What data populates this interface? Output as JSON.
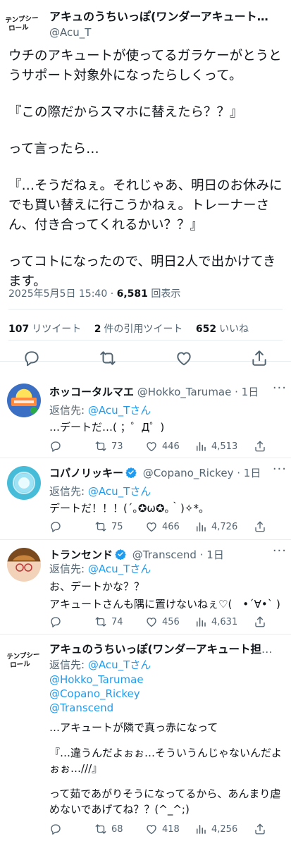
{
  "main_tweet": {
    "logo_line1": "テンプシー",
    "logo_line2": "ロール",
    "author_name": "アキュのうちいっぽ(ワンダーアキュート担当…",
    "author_handle": "@Acu_T",
    "text_paragraphs": [
      "ウチのアキュートが使ってるガラケーがとうとうサポート対象外になったらしくって。",
      "『この際だからスマホに替えたら？？』",
      "って言ったら…",
      "『…そうだねぇ。それじゃあ、明日のお休みにでも買い替えに行こうかねぇ。トレーナーさん、付き合ってくれるかい？？』",
      "ってコトになったので、明日2人で出かけてきます。"
    ],
    "timestamp": "2025年5月5日 15:40",
    "separator": "·",
    "views_count": "6,581",
    "views_label": "回表示",
    "retweets_count": "107",
    "retweets_label": "リツイート",
    "quotes_count": "2",
    "quotes_label": "件の引用ツイート",
    "likes_count": "652",
    "likes_label": "いいね"
  },
  "replies": [
    {
      "name": "ホッコータルマエ",
      "handle": "@Hokko_Tarumae",
      "time": "· 1日",
      "verified": false,
      "replying_label": "返信先:",
      "replying_to": "@Acu_Tさん",
      "text_lines": [
        "…デートだ…( ；゜Д゜)"
      ],
      "retweets": "73",
      "likes": "446",
      "views": "4,513",
      "avatar_color": "#3a6fc4"
    },
    {
      "name": "コパノリッキー",
      "handle": "@Copano_Rickey",
      "time": "· 1日",
      "verified": true,
      "replying_label": "返信先:",
      "replying_to": "@Acu_Tさん",
      "text_lines": [
        "デートだ！！！(´｡✪ω✪｡｀)✧*。"
      ],
      "retweets": "75",
      "likes": "466",
      "views": "4,726",
      "avatar_color": "#46bcd9"
    },
    {
      "name": "トランセンド",
      "handle": "@Transcend",
      "time": "· 1日",
      "verified": true,
      "replying_label": "返信先:",
      "replying_to": "@Acu_Tさん",
      "text_lines": [
        "お、デートかな？？",
        "アキュートさんも隅に置けないねぇ♡(　•´∀•` )"
      ],
      "retweets": "74",
      "likes": "456",
      "views": "4,631",
      "avatar_color": "#c9853e"
    },
    {
      "name": "アキュのうちいっぽ(ワンダーアキュート担当ト…",
      "handle": "",
      "time": "",
      "verified": false,
      "logo_line1": "テンプシー",
      "logo_line2": "ロール",
      "replying_label": "返信先:",
      "replying_to": "@Acu_Tさん",
      "mentions": [
        "@Hokko_Tarumae",
        "@Copano_Rickey",
        "@Transcend"
      ],
      "text_lines": [
        "…アキュートが隣で真っ赤になって",
        "『…違うんだよぉぉ…そういうんじゃないんだよぉぉ…///』",
        "って茹であがりそうになってるから、あんまり虐めないであげてね？？(^_^;)"
      ],
      "retweets": "68",
      "likes": "418",
      "views": "4,256"
    }
  ],
  "colors": {
    "text": "#0f1419",
    "muted": "#536471",
    "link": "#1d9bf0",
    "divider": "#e6ecf0",
    "verified_badge": "#1d9bf0"
  }
}
